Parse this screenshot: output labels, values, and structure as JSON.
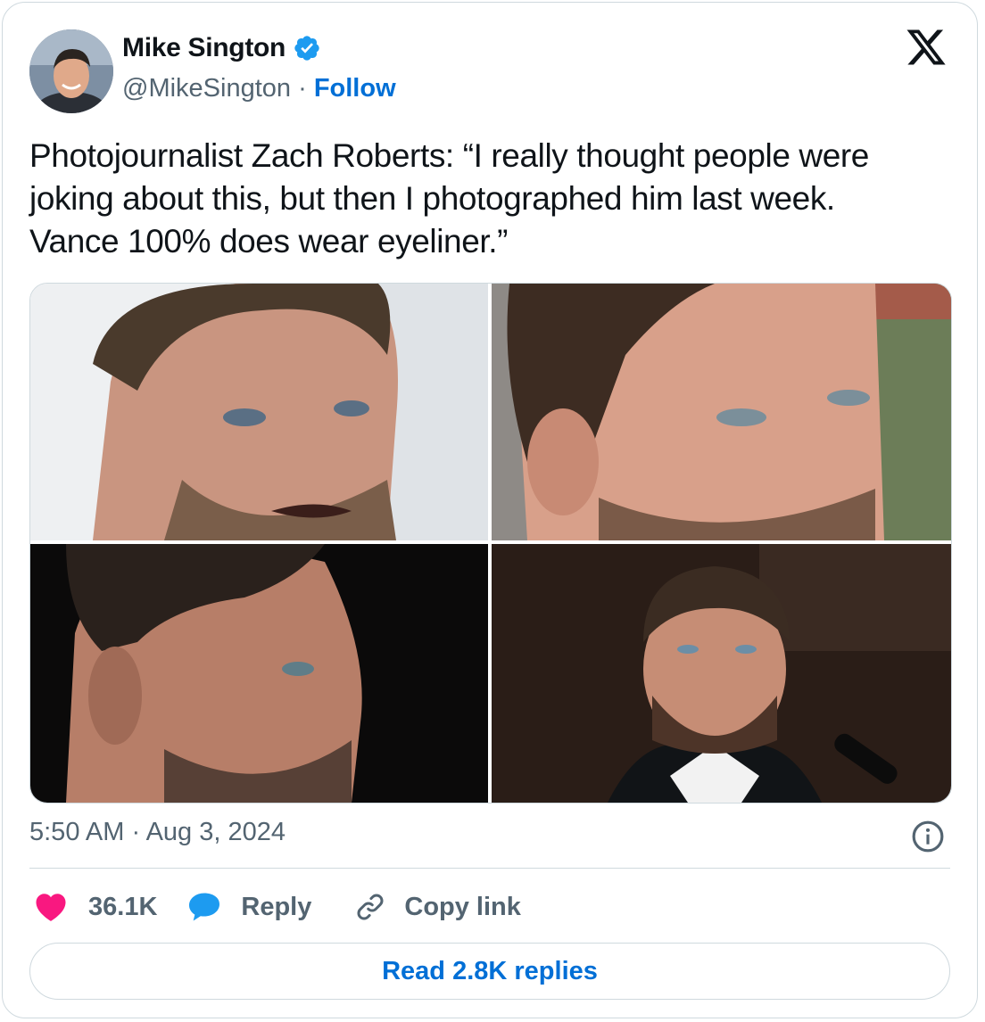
{
  "author": {
    "name": "Mike Sington",
    "handle": "@MikeSington",
    "separator": " · ",
    "follow_label": "Follow",
    "verified_color": "#1d9bf0"
  },
  "platform_icon": "x-logo-icon",
  "tweet": {
    "lines": [
      "Photojournalist Zach Roberts: “I really thought people were",
      "joking about this, but then I photographed him last week.",
      "Vance 100% does wear eyeliner.”"
    ]
  },
  "media": {
    "count": 4
  },
  "timestamp": "5:50 AM · Aug 3, 2024",
  "actions": {
    "like_count": "36.1K",
    "reply_label": "Reply",
    "copy_link_label": "Copy link",
    "like_color": "#f91880",
    "reply_color": "#1d9bf0"
  },
  "read_replies_label": "Read 2.8K replies",
  "colors": {
    "link_blue": "#006fd6",
    "secondary_text": "#536471",
    "border": "#cfd9de"
  }
}
